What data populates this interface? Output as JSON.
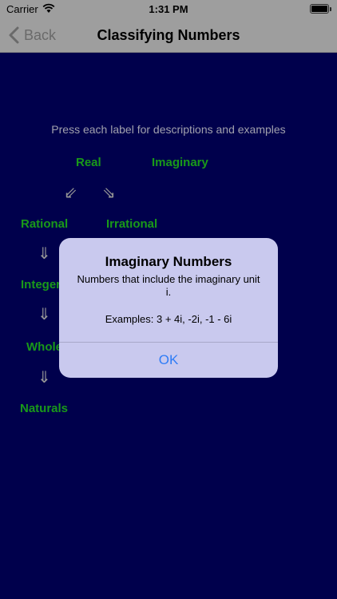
{
  "status_bar": {
    "carrier": "Carrier",
    "time": "1:31 PM"
  },
  "nav": {
    "back_label": "Back",
    "title": "Classifying Numbers"
  },
  "instructions": "Press each label for descriptions and examples",
  "terms": {
    "real": "Real",
    "imaginary": "Imaginary",
    "rational": "Rational",
    "irrational": "Irrational",
    "integers": "Integers",
    "wholes": "Wholes",
    "naturals": "Naturals"
  },
  "arrows": {
    "down_left": "⇙",
    "down_right": "⇘",
    "down": "⇓"
  },
  "alert": {
    "title": "Imaginary Numbers",
    "message": "Numbers that include the imaginary unit i.",
    "examples": "Examples: 3 + 4i, -2i, -1 - 6i",
    "ok_label": "OK"
  },
  "colors": {
    "background": "#000066",
    "term_green": "#22cc22",
    "alert_bg": "#c9c9ee",
    "ok_blue": "#2f7cf6"
  }
}
